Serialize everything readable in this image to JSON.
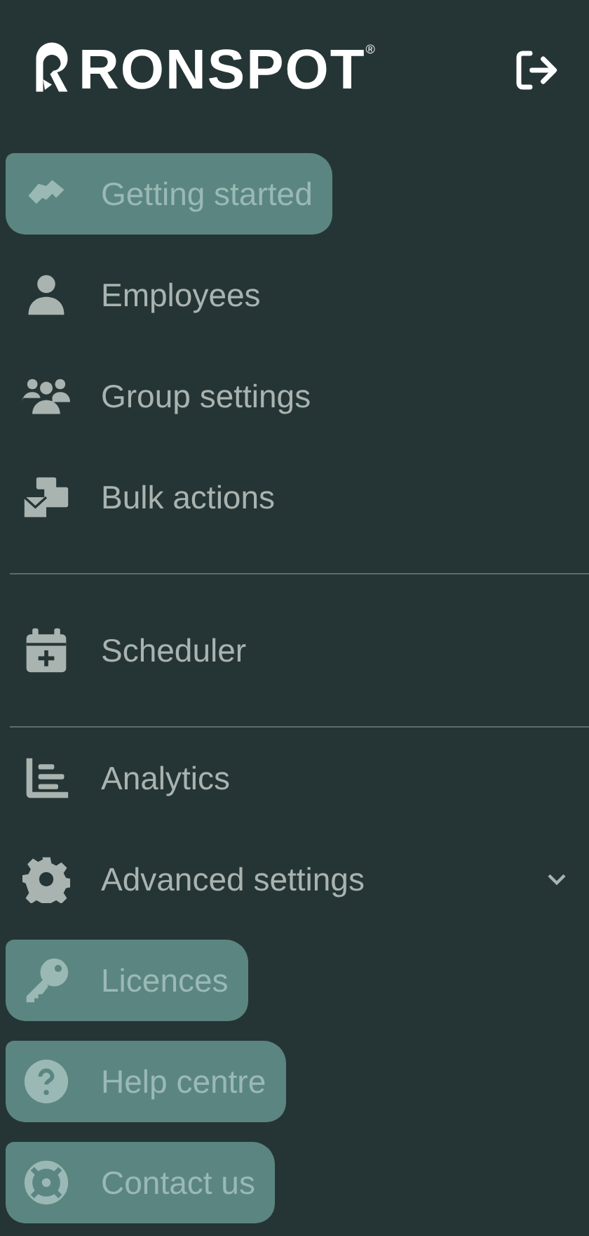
{
  "header": {
    "logo_text": "RONSPOT",
    "logo_mark": "®"
  },
  "sections": [
    {
      "items": [
        {
          "label": "Getting started",
          "highlighted": true
        },
        {
          "label": "Employees",
          "highlighted": false
        },
        {
          "label": "Group settings",
          "highlighted": false
        },
        {
          "label": "Bulk actions",
          "highlighted": false
        }
      ]
    },
    {
      "items": [
        {
          "label": "Scheduler",
          "highlighted": false
        }
      ]
    },
    {
      "items": [
        {
          "label": "Analytics",
          "highlighted": false
        },
        {
          "label": "Advanced settings",
          "highlighted": false,
          "expanded": false
        },
        {
          "label": "Licences",
          "highlighted": true
        },
        {
          "label": "Help centre",
          "highlighted": true
        },
        {
          "label": "Contact us",
          "highlighted": true
        }
      ]
    }
  ]
}
